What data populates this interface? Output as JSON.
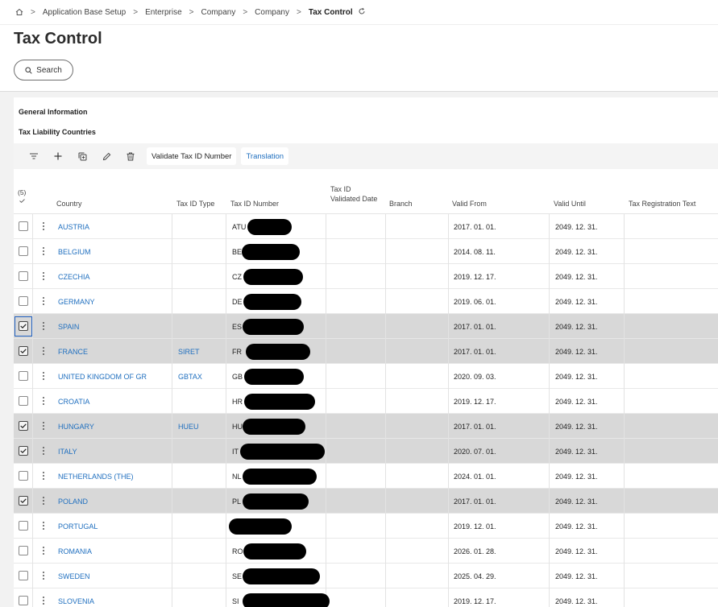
{
  "breadcrumb": {
    "items": [
      "Application Base Setup",
      "Enterprise",
      "Company",
      "Company"
    ],
    "current": "Tax Control"
  },
  "page": {
    "title": "Tax Control"
  },
  "search": {
    "label": "Search"
  },
  "sections": {
    "general": "General Information",
    "tax_liability": "Tax Liability Countries"
  },
  "toolbar": {
    "validate_label": "Validate Tax ID Number",
    "translation_label": "Translation"
  },
  "grid": {
    "selected_count": "(5)",
    "columns": {
      "country": "Country",
      "tax_id_type": "Tax ID Type",
      "tax_id_number": "Tax ID Number",
      "tax_id_validated_1": "Tax ID",
      "tax_id_validated_2": "Validated Date",
      "branch": "Branch",
      "valid_from": "Valid From",
      "valid_until": "Valid Until",
      "tax_reg_text": "Tax Registration Text"
    },
    "rows": [
      {
        "country": "AUSTRIA",
        "type": "",
        "prefix": "ATU",
        "valid_from": "2017. 01. 01.",
        "valid_until": "2049. 12. 31.",
        "selected": false
      },
      {
        "country": "BELGIUM",
        "type": "",
        "prefix": "BE",
        "valid_from": "2014. 08. 11.",
        "valid_until": "2049. 12. 31.",
        "selected": false
      },
      {
        "country": "CZECHIA",
        "type": "",
        "prefix": "CZ",
        "valid_from": "2019. 12. 17.",
        "valid_until": "2049. 12. 31.",
        "selected": false
      },
      {
        "country": "GERMANY",
        "type": "",
        "prefix": "DE",
        "valid_from": "2019. 06. 01.",
        "valid_until": "2049. 12. 31.",
        "selected": false
      },
      {
        "country": "SPAIN",
        "type": "",
        "prefix": "ES",
        "valid_from": "2017. 01. 01.",
        "valid_until": "2049. 12. 31.",
        "selected": true
      },
      {
        "country": "FRANCE",
        "type": "SIRET",
        "prefix": "FR",
        "valid_from": "2017. 01. 01.",
        "valid_until": "2049. 12. 31.",
        "selected": true
      },
      {
        "country": "UNITED KINGDOM OF GR",
        "type": "GBTAX",
        "prefix": "GB",
        "valid_from": "2020. 09. 03.",
        "valid_until": "2049. 12. 31.",
        "selected": false
      },
      {
        "country": "CROATIA",
        "type": "",
        "prefix": "HR",
        "valid_from": "2019. 12. 17.",
        "valid_until": "2049. 12. 31.",
        "selected": false
      },
      {
        "country": "HUNGARY",
        "type": "HUEU",
        "prefix": "HU",
        "valid_from": "2017. 01. 01.",
        "valid_until": "2049. 12. 31.",
        "selected": true
      },
      {
        "country": "ITALY",
        "type": "",
        "prefix": "IT",
        "valid_from": "2020. 07. 01.",
        "valid_until": "2049. 12. 31.",
        "selected": true
      },
      {
        "country": "NETHERLANDS (THE)",
        "type": "",
        "prefix": "NL",
        "valid_from": "2024. 01. 01.",
        "valid_until": "2049. 12. 31.",
        "selected": false
      },
      {
        "country": "POLAND",
        "type": "",
        "prefix": "PL",
        "valid_from": "2017. 01. 01.",
        "valid_until": "2049. 12. 31.",
        "selected": true
      },
      {
        "country": "PORTUGAL",
        "type": "",
        "prefix": "",
        "valid_from": "2019. 12. 01.",
        "valid_until": "2049. 12. 31.",
        "selected": false
      },
      {
        "country": "ROMANIA",
        "type": "",
        "prefix": "RO",
        "valid_from": "2026. 01. 28.",
        "valid_until": "2049. 12. 31.",
        "selected": false
      },
      {
        "country": "SWEDEN",
        "type": "",
        "prefix": "SE",
        "valid_from": "2025. 04. 29.",
        "valid_until": "2049. 12. 31.",
        "selected": false
      },
      {
        "country": "SLOVENIA",
        "type": "",
        "prefix": "SI",
        "valid_from": "2019. 12. 17.",
        "valid_until": "2049. 12. 31.",
        "selected": false
      }
    ]
  },
  "colors": {
    "link": "#1f6fbf",
    "selected_row": "#d8d8d8",
    "toolbar_bg": "#f4f4f4"
  }
}
